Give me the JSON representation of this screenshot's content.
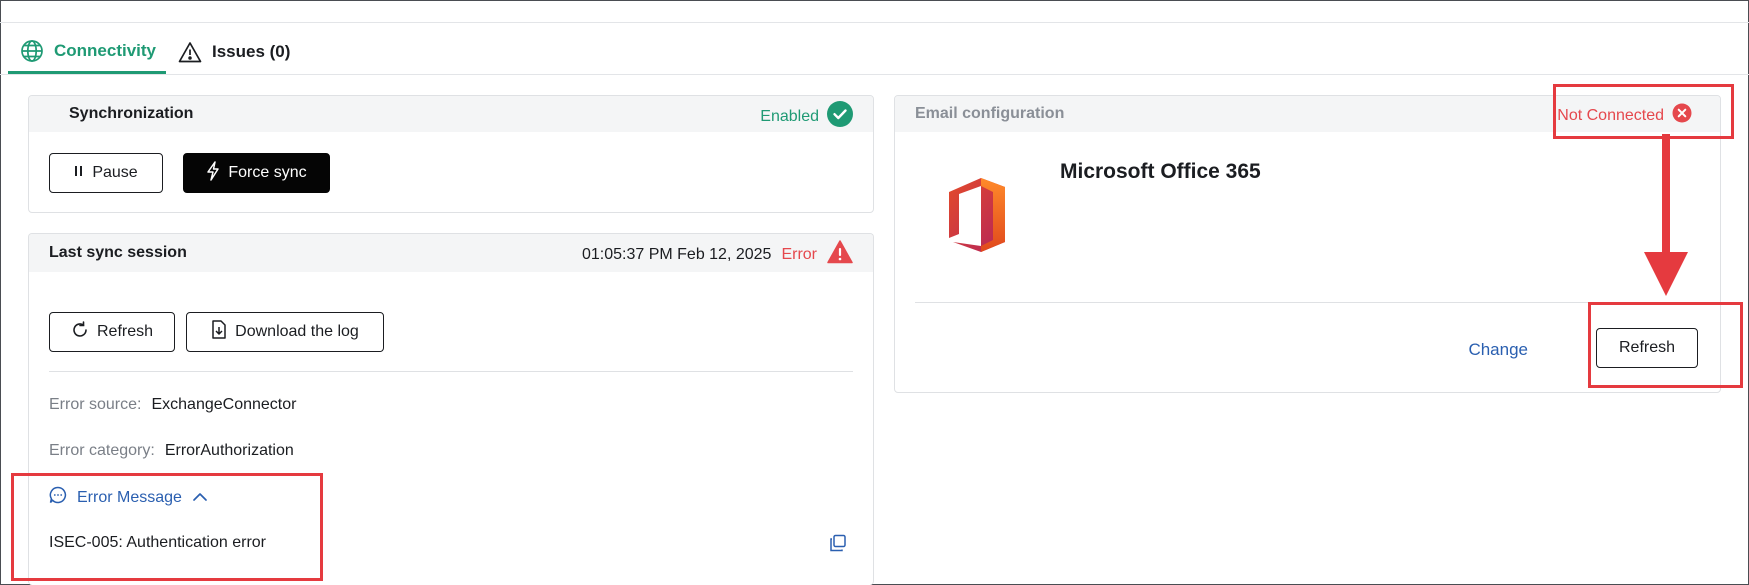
{
  "tabs": [
    {
      "label": "Connectivity",
      "icon": "globe-icon",
      "active": true
    },
    {
      "label": "Issues (0)",
      "icon": "warning-icon",
      "active": false
    }
  ],
  "sync": {
    "title": "Synchronization",
    "status": "Enabled",
    "pause_label": "Pause",
    "force_sync_label": "Force sync"
  },
  "session": {
    "title": "Last sync session",
    "timestamp": "01:05:37 PM Feb 12, 2025",
    "status": "Error",
    "refresh_label": "Refresh",
    "download_label": "Download the log",
    "error_source_label": "Error source:",
    "error_source_value": "ExchangeConnector",
    "error_category_label": "Error category:",
    "error_category_value": "ErrorAuthorization",
    "error_message_toggle": "Error Message",
    "error_message_text": "ISEC-005: Authentication error"
  },
  "email": {
    "title": "Email configuration",
    "status": "Not Connected",
    "provider": "Microsoft Office 365",
    "change_label": "Change",
    "refresh_label": "Refresh"
  },
  "colors": {
    "accent_green": "#1f9a74",
    "error_red": "#e5484d",
    "link_blue": "#2a5fb0",
    "annotation_red": "#e53a3f"
  }
}
